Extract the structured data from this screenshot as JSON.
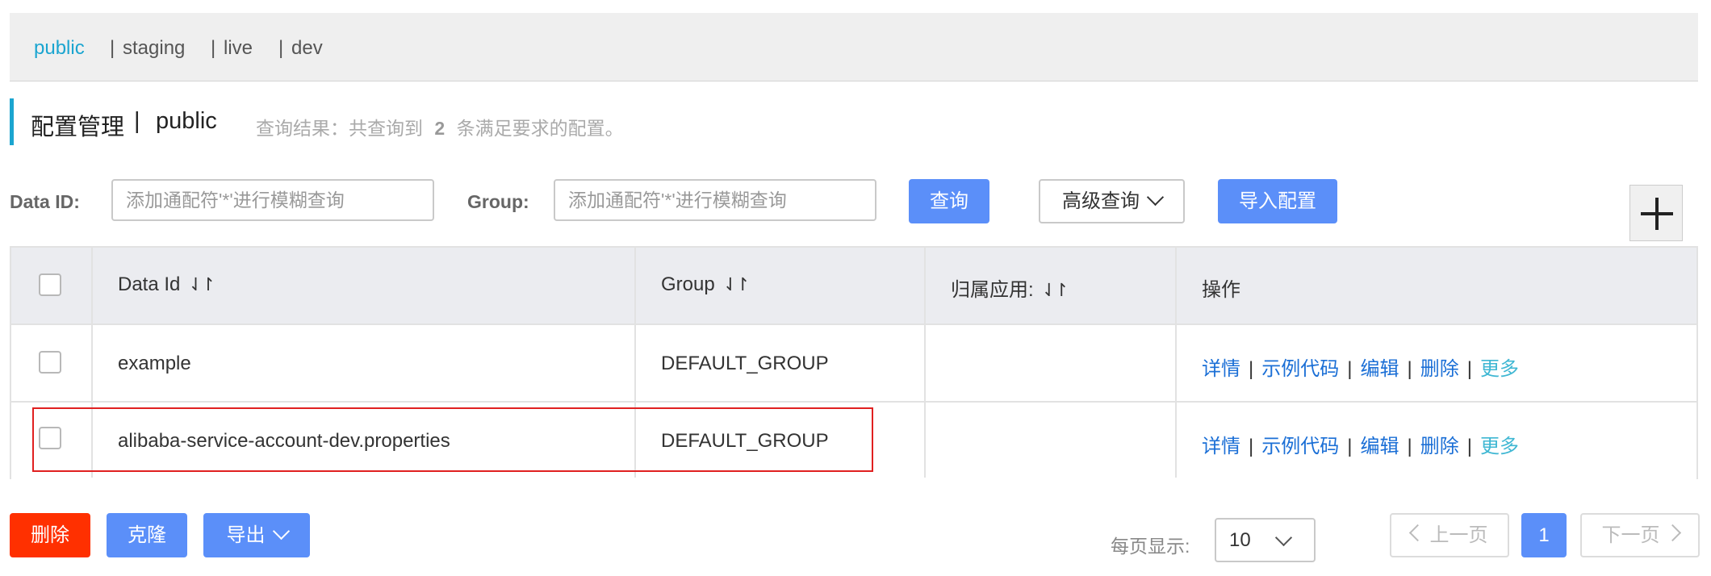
{
  "namespaces": {
    "items": [
      "public",
      "staging",
      "live",
      "dev"
    ],
    "separator": "|"
  },
  "header": {
    "title": "配置管理",
    "separator": "|",
    "namespace": "public",
    "result_prefix": "查询结果：共查询到",
    "result_count": "2",
    "result_suffix": "条满足要求的配置。"
  },
  "search": {
    "data_id_label": "Data ID:",
    "data_id_placeholder": "添加通配符'*'进行模糊查询",
    "group_label": "Group:",
    "group_placeholder": "添加通配符'*'进行模糊查询",
    "query_button": "查询",
    "advanced_button": "高级查询",
    "import_button": "导入配置"
  },
  "table": {
    "columns": [
      "Data Id",
      "Group",
      "归属应用:",
      "操作"
    ],
    "sort_icon": "⇃↾",
    "rows": [
      {
        "data_id": "example",
        "group": "DEFAULT_GROUP",
        "app": ""
      },
      {
        "data_id": "alibaba-service-account-dev.properties",
        "group": "DEFAULT_GROUP",
        "app": ""
      }
    ],
    "operations": [
      "详情",
      "示例代码",
      "编辑",
      "删除",
      "更多"
    ],
    "op_separator": "|"
  },
  "footer": {
    "delete_button": "删除",
    "clone_button": "克隆",
    "export_button": "导出",
    "page_size_label": "每页显示:",
    "page_size": "10",
    "prev_label": "上一页",
    "current_page": "1",
    "next_label": "下一页"
  },
  "colors": {
    "primary": "#5b8ff9",
    "accent": "#1ba5d0",
    "danger": "#ff3000",
    "link": "#1b6fd6",
    "highlight": "#e02020"
  }
}
